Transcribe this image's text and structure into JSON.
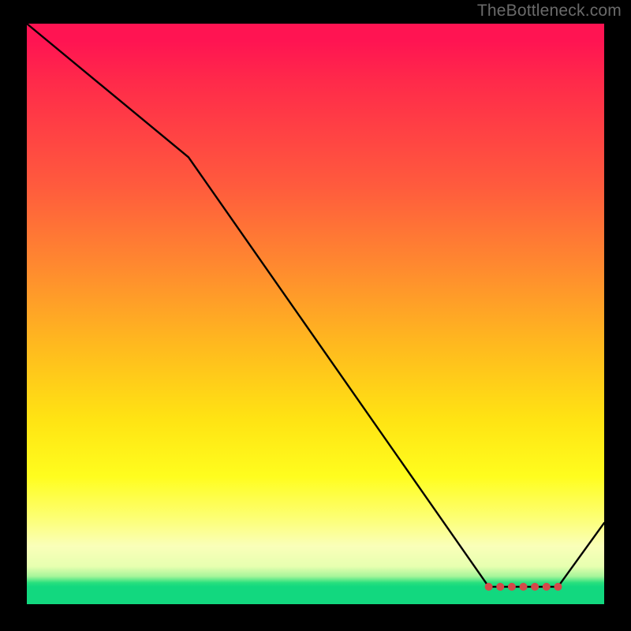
{
  "credit": "TheBottleneck.com",
  "colors": {
    "background": "#000000",
    "curve": "#000000",
    "marker": "#d44a4a",
    "gradient_top": "#ff1452",
    "gradient_bottom": "#12d87f"
  },
  "chart_data": {
    "type": "line",
    "title": "",
    "xlabel": "",
    "ylabel": "",
    "xlim": [
      0,
      100
    ],
    "ylim": [
      0,
      100
    ],
    "x": [
      0,
      28,
      80,
      82,
      84,
      86,
      88,
      90,
      92,
      100
    ],
    "values": [
      100,
      77,
      3,
      3,
      3,
      3,
      3,
      3,
      3,
      14
    ],
    "flat_region_x": [
      80,
      82,
      84,
      86,
      88,
      90,
      92
    ],
    "flat_region_y": 3
  }
}
